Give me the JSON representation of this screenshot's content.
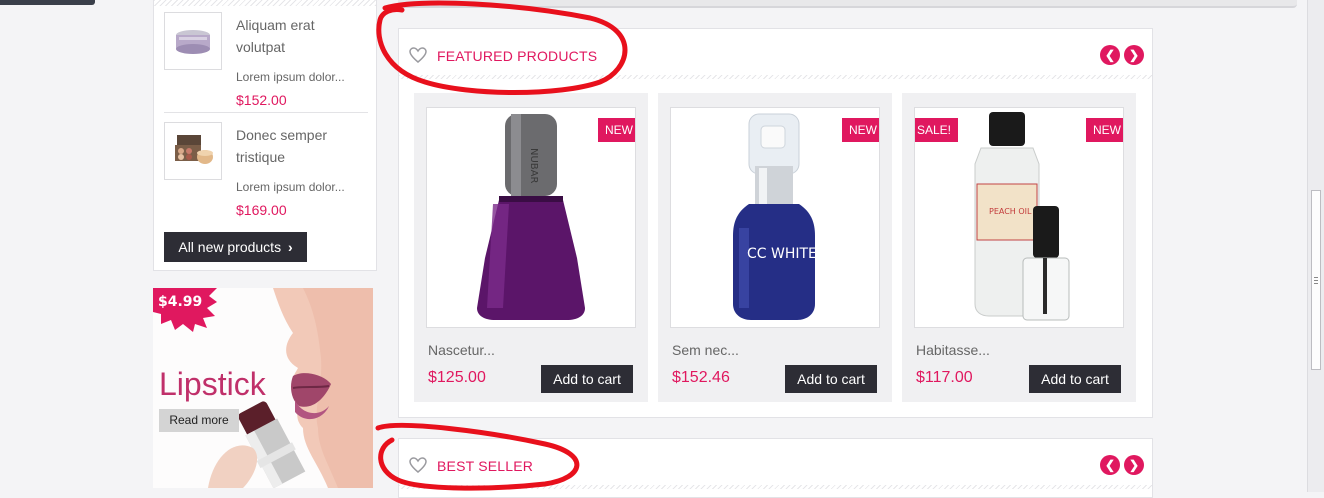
{
  "new_products": {
    "items": [
      {
        "name": "Aliquam erat volutpat",
        "description": "Lorem ipsum dolor...",
        "price": "$152.00"
      },
      {
        "name": "Donec semper tristique",
        "description": "Lorem ipsum dolor...",
        "price": "$169.00"
      }
    ],
    "all_button": "All new products"
  },
  "ad": {
    "price": "$4.99",
    "title": "Lipstick",
    "button": "Read more"
  },
  "featured": {
    "title": "FEATURED PRODUCTS",
    "products": [
      {
        "name": "Nascetur...",
        "price": "$125.00",
        "badges": [
          "NEW"
        ],
        "button": "Add to cart"
      },
      {
        "name": "Sem nec...",
        "price": "$152.46",
        "badges": [
          "NEW"
        ],
        "button": "Add to cart"
      },
      {
        "name": "Habitasse...",
        "price": "$117.00",
        "badges": [
          "SALE!",
          "NEW"
        ],
        "button": "Add to cart"
      }
    ]
  },
  "best_seller": {
    "title": "BEST SELLER"
  },
  "product_art": {
    "nail_polish_brand": "NUBAR",
    "bottle_text": "CC WHITE ホワイト",
    "peach_oil_label": "PEACH OIL"
  },
  "colors": {
    "accent": "#e0185f",
    "dark_button": "#2d2d35",
    "annotation": "#e8101c"
  },
  "icons": {
    "heart": "heart-icon",
    "prev": "chevron-left-icon",
    "next": "chevron-right-icon",
    "chevron": "chevron-right-icon"
  }
}
